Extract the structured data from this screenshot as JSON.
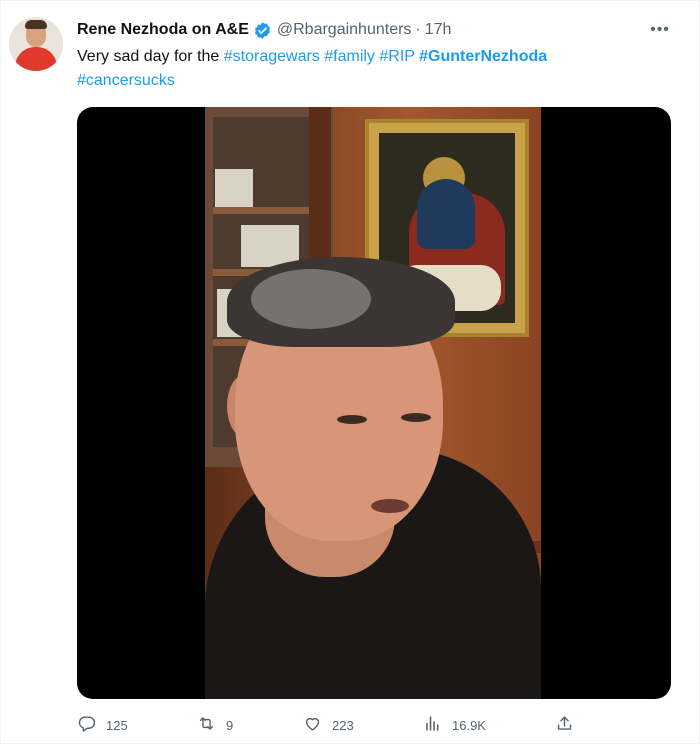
{
  "tweet": {
    "author_name": "Rene Nezhoda on A&E",
    "handle": "@Rbargainhunters",
    "separator": "·",
    "time": "17h",
    "more_glyph": "•••",
    "text": {
      "lead": "Very sad day for the ",
      "hashtags": [
        "#storagewars",
        "#family",
        "#RIP",
        "#GunterNezhoda",
        "#cancersucks"
      ]
    },
    "colors": {
      "link": "#1d9bf0",
      "secondary_text": "#536471",
      "verified": "#1d9bf0"
    }
  },
  "actions": {
    "reply": {
      "icon": "reply-icon",
      "count": "125"
    },
    "retweet": {
      "icon": "retweet-icon",
      "count": "9"
    },
    "like": {
      "icon": "heart-icon",
      "count": "223"
    },
    "views": {
      "icon": "views-icon",
      "count": "16.9K"
    },
    "share": {
      "icon": "share-icon"
    }
  }
}
